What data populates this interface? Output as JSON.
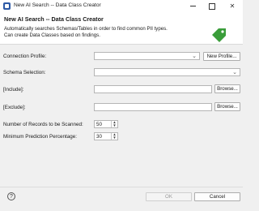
{
  "window": {
    "title": "New AI Search -- Data Class Creator",
    "minimize_glyph": "",
    "close_glyph": "✕"
  },
  "header": {
    "title": "New AI Search -- Data Class Creator",
    "description_line1": "Automatically searches Schemas/Tables in order to find common PII types.",
    "description_line2": "Can create Data Classes based on findings.",
    "icon": "tag-icon",
    "icon_color": "#3a9d3a"
  },
  "form": {
    "connection_profile_label": "Connection Profile:",
    "connection_profile_value": "",
    "new_profile_button": "New Profile...",
    "schema_selection_label": "Schema Selection:",
    "schema_selection_value": "",
    "include_label": "[Include]:",
    "include_value": "",
    "exclude_label": "[Exclude]:",
    "exclude_value": "",
    "browse_button": "Browse...",
    "records_label": "Number of Records to be Scanned:",
    "records_value": "50",
    "prediction_label": "Minimum Prediction Percentage:",
    "prediction_value": "30"
  },
  "footer": {
    "help_glyph": "?",
    "ok_button": "OK",
    "cancel_button": "Cancel"
  }
}
